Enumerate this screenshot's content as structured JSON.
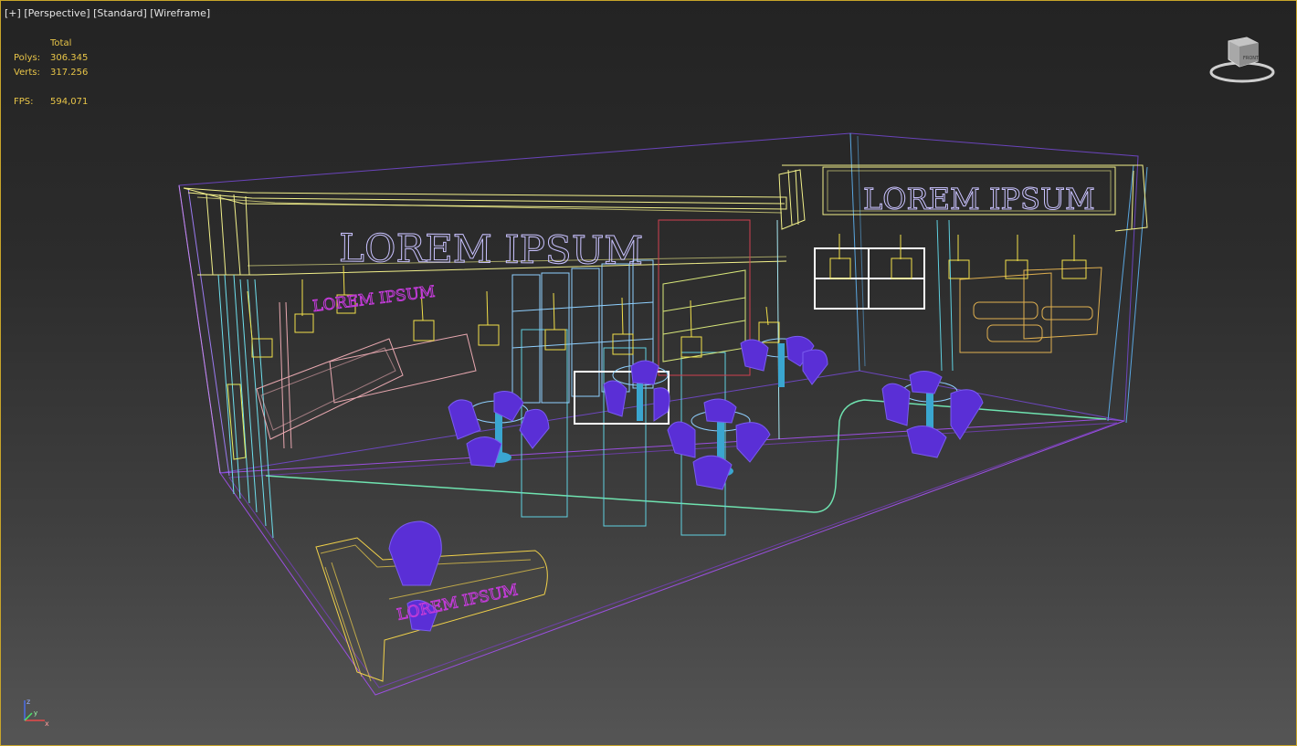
{
  "viewport_label": {
    "plus": "[+]",
    "view": "[Perspective]",
    "shading": "[Standard]",
    "mode": "[Wireframe]"
  },
  "stats": {
    "header": "Total",
    "polys_label": "Polys:",
    "polys_value": "306.345",
    "verts_label": "Verts:",
    "verts_value": "317.256",
    "fps_label": "FPS:",
    "fps_value": "594,071"
  },
  "scene": {
    "main_sign": "LOREM IPSUM",
    "right_sign": "LOREM IPSUM",
    "small_sign": "LOREM IPSUM",
    "counter_sign": "LOREM IPSUM"
  },
  "viewcube": {
    "face_label": "FRONT"
  },
  "axis": {
    "x": "x",
    "y": "y",
    "z": "z"
  },
  "colors": {
    "border": "#c8a52a",
    "stats_text": "#e8c548",
    "wire_yellow": "#f2f08a",
    "wire_cyan": "#6ee0ee",
    "wire_purple": "#8b5cf6",
    "chair": "#5a2fd6",
    "sign_text": "#c9c2ff",
    "magenta": "#c23bd8"
  }
}
